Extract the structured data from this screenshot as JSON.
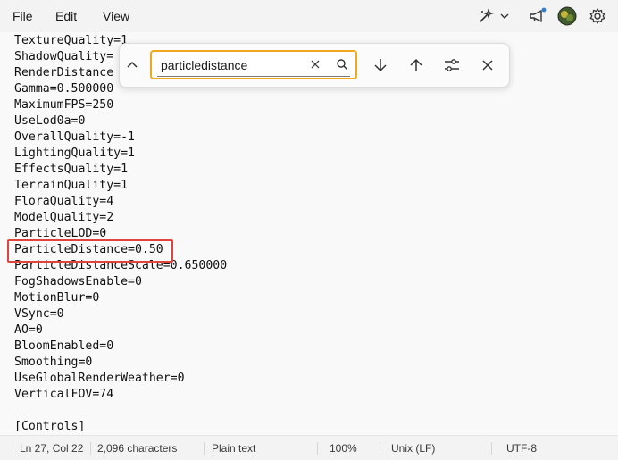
{
  "menu": {
    "file": "File",
    "edit": "Edit",
    "view": "View"
  },
  "find": {
    "query": "particledistance"
  },
  "editor": {
    "lines": [
      "TextureQuality=1",
      "ShadowQuality=",
      "RenderDistance",
      "Gamma=0.500000",
      "MaximumFPS=250",
      "UseLod0a=0",
      "OverallQuality=-1",
      "LightingQuality=1",
      "EffectsQuality=1",
      "TerrainQuality=1",
      "FloraQuality=4",
      "ModelQuality=2",
      "ParticleLOD=0",
      "ParticleDistance=0.50",
      "ParticleDistanceScale=0.650000",
      "FogShadowsEnable=0",
      "MotionBlur=0",
      "VSync=0",
      "AO=0",
      "BloomEnabled=0",
      "Smoothing=0",
      "UseGlobalRenderWeather=0",
      "VerticalFOV=74",
      "",
      "[Controls]"
    ]
  },
  "status": {
    "position": "Ln 27, Col 22",
    "characters": "2,096 characters",
    "format": "Plain text",
    "zoom": "100%",
    "line_ending": "Unix (LF)",
    "encoding": "UTF-8"
  },
  "colors": {
    "highlight": "#e0443f",
    "search_outline": "#f0a81c",
    "notification_dot": "#2a7fd4"
  }
}
